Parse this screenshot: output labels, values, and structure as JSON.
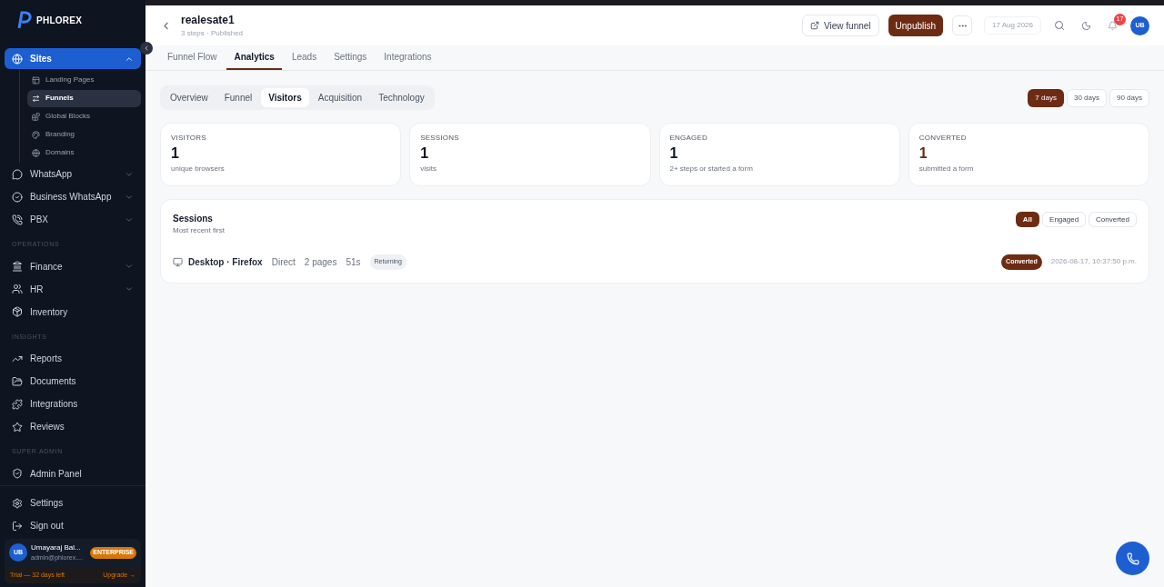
{
  "sidebar": {
    "logo": "PHLOREX",
    "sections": [
      {
        "items": [
          {
            "label": "Sites",
            "selected": true,
            "expanded": true,
            "children": [
              {
                "label": "Landing Pages",
                "selected": false
              },
              {
                "label": "Funnels",
                "selected": true
              },
              {
                "label": "Global Blocks",
                "selected": false
              },
              {
                "label": "Branding",
                "selected": false
              },
              {
                "label": "Domains",
                "selected": false
              }
            ]
          },
          {
            "label": "WhatsApp",
            "selected": false,
            "expanded": false
          },
          {
            "label": "Business WhatsApp",
            "selected": false,
            "expanded": false
          },
          {
            "label": "PBX",
            "selected": false,
            "expanded": false
          }
        ]
      },
      {
        "heading": "OPERATIONS",
        "items": [
          {
            "label": "Finance",
            "selected": false,
            "expanded": false
          },
          {
            "label": "HR",
            "selected": false,
            "expanded": false
          },
          {
            "label": "Inventory",
            "selected": false
          }
        ]
      },
      {
        "heading": "INSIGHTS",
        "items": [
          {
            "label": "Reports",
            "selected": false
          },
          {
            "label": "Documents",
            "selected": false
          },
          {
            "label": "Integrations",
            "selected": false
          },
          {
            "label": "Reviews",
            "selected": false
          }
        ]
      },
      {
        "heading": "SUPER ADMIN",
        "items": [
          {
            "label": "Admin Panel",
            "selected": false
          }
        ]
      }
    ],
    "footer_items": [
      {
        "label": "Settings"
      },
      {
        "label": "Sign out"
      }
    ],
    "user": {
      "initials": "UB",
      "name": "Umayaraj Bal...",
      "email": "admin@phlorex....",
      "badge": "ENTERPRISE"
    },
    "trial": {
      "text": "Trial — 32 days left",
      "link": "Upgrade →"
    }
  },
  "header": {
    "title": "realesate1",
    "subtitle": "3 steps · Published",
    "view_button": "View funnel",
    "publish_button": "Unpublish",
    "date": "17 Aug 2026",
    "notification_count": "17",
    "avatar": "UB"
  },
  "tabs": [
    {
      "label": "Funnel Flow",
      "selected": false
    },
    {
      "label": "Analytics",
      "selected": true
    },
    {
      "label": "Leads",
      "selected": false
    },
    {
      "label": "Settings",
      "selected": false
    },
    {
      "label": "Integrations",
      "selected": false
    }
  ],
  "subtabs": [
    {
      "label": "Overview",
      "selected": false
    },
    {
      "label": "Funnel",
      "selected": false
    },
    {
      "label": "Visitors",
      "selected": true
    },
    {
      "label": "Acquisition",
      "selected": false
    },
    {
      "label": "Technology",
      "selected": false
    }
  ],
  "ranges": [
    {
      "label": "7 days",
      "selected": true
    },
    {
      "label": "30 days",
      "selected": false
    },
    {
      "label": "90 days",
      "selected": false
    }
  ],
  "stats": [
    {
      "label": "VISITORS",
      "value": "1",
      "caption": "unique browsers",
      "highlight": false
    },
    {
      "label": "SESSIONS",
      "value": "1",
      "caption": "visits",
      "highlight": false
    },
    {
      "label": "ENGAGED",
      "value": "1",
      "caption": "2+ steps or started a form",
      "highlight": false
    },
    {
      "label": "CONVERTED",
      "value": "1",
      "caption": "submitted a form",
      "highlight": true
    }
  ],
  "sessions": {
    "title": "Sessions",
    "subtitle": "Most recent first",
    "filters": [
      {
        "label": "All",
        "selected": true
      },
      {
        "label": "Engaged",
        "selected": false
      },
      {
        "label": "Converted",
        "selected": false
      }
    ],
    "rows": [
      {
        "device": "Desktop · Firefox",
        "source": "Direct",
        "pages": "2 pages",
        "duration": "51s",
        "tag": "Returning",
        "status": "Converted",
        "time": "2026-08-17, 10:37:50 p.m."
      }
    ]
  }
}
